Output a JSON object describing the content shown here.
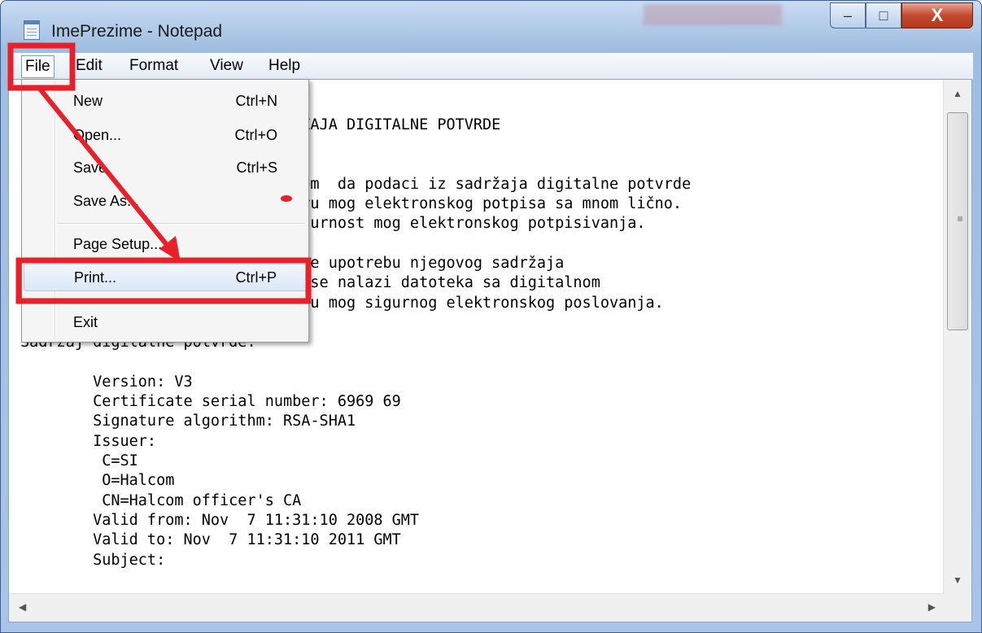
{
  "window": {
    "title": "ImePrezime - Notepad",
    "minimize_glyph": "‒",
    "maximize_glyph": "□",
    "close_glyph": "X"
  },
  "menubar": {
    "items": [
      "File",
      "Edit",
      "Format",
      "View",
      "Help"
    ]
  },
  "file_menu": {
    "items": [
      {
        "label": "New",
        "shortcut": "Ctrl+N"
      },
      {
        "label": "Open...",
        "shortcut": "Ctrl+O"
      },
      {
        "label": "Save",
        "shortcut": "Ctrl+S"
      },
      {
        "label": "Save As...",
        "shortcut": ""
      },
      {
        "label": "Page Setup...",
        "shortcut": ""
      },
      {
        "label": "Print...",
        "shortcut": "Ctrl+P"
      },
      {
        "label": "Exit",
        "shortcut": ""
      }
    ]
  },
  "document": {
    "text": "                              RŽAJA DIGITALNE POTVRDE\n\n\n                              jem  da podaci iz sadržaja digitalne potvrde\n                              eru mog elektronskog potpisa sa mnom lično.\n                              igurnost mog elektronskog potpisivanja.\n\n                              ave upotrebu njegovog sadržaja\n                              m se nalazi datoteka sa digitalnom\n                              rhu mog sigurnog elektronskog poslovanja.\n\nSadržaj digitalne potvrde:\n\n        Version: V3\n        Certificate serial number: 6969 69\n        Signature algorithm: RSA-SHA1\n        Issuer:\n         C=SI\n         O=Halcom\n         CN=Halcom officer's CA\n        Valid from: Nov  7 11:31:10 2008 GMT\n        Valid to: Nov  7 11:31:10 2011 GMT\n        Subject:"
  },
  "colors": {
    "annotation_red": "#e8202a",
    "titlebar_blue": "#b9d1ee",
    "close_red": "#c44a2f"
  },
  "icons": {
    "app": "notepad-icon",
    "scroll_up": "▲",
    "scroll_down": "▼",
    "scroll_left": "◀",
    "scroll_right": "▶",
    "grip": "≡"
  }
}
